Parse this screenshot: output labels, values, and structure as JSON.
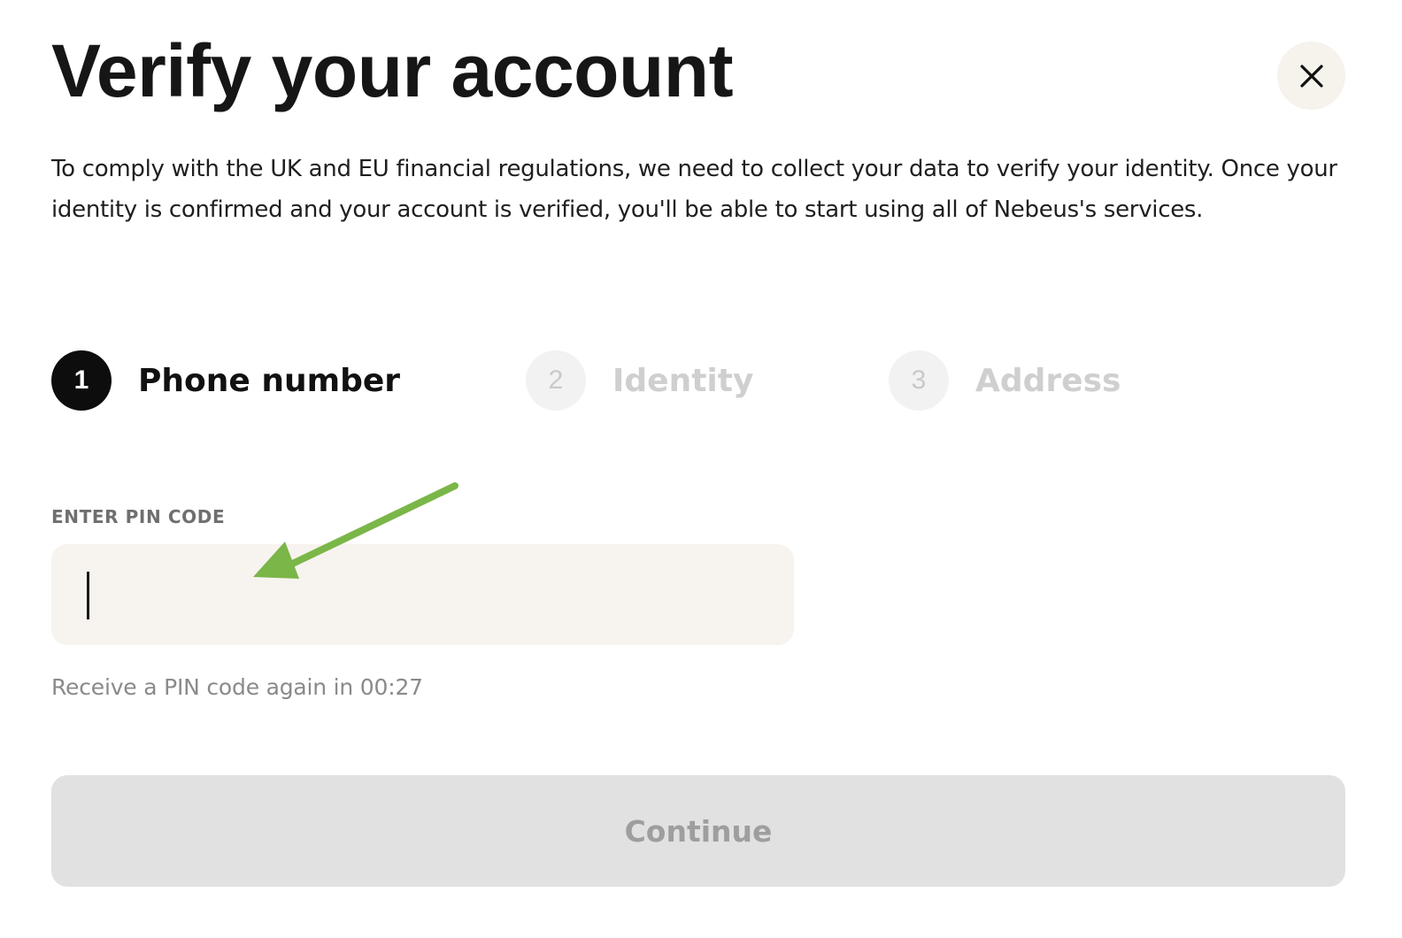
{
  "header": {
    "title": "Verify your account",
    "close_icon": "close-icon"
  },
  "intro": {
    "text": "To comply with the UK and EU financial regulations, we need to collect your data to verify your identity. Once your identity is confirmed and your account is verified, you'll be able to start using all of Nebeus's services."
  },
  "stepper": {
    "active_step": 1,
    "steps": [
      {
        "number": "1",
        "label": "Phone number",
        "state": "active"
      },
      {
        "number": "2",
        "label": "Identity",
        "state": "inactive"
      },
      {
        "number": "3",
        "label": "Address",
        "state": "inactive"
      }
    ]
  },
  "pin": {
    "label": "ENTER PIN CODE",
    "value": "",
    "placeholder": "",
    "resend_text": "Receive a PIN code again in 00:27"
  },
  "annotation": {
    "arrow_color": "#7ab648",
    "arrow_icon": "arrow-annotation-icon"
  },
  "actions": {
    "continue_label": "Continue",
    "continue_disabled": true
  },
  "colors": {
    "active_step": "#0d0d0d",
    "inactive_step": "#f2f2f2",
    "input_background": "#f7f3ee",
    "button_disabled": "#e1e1e1"
  }
}
